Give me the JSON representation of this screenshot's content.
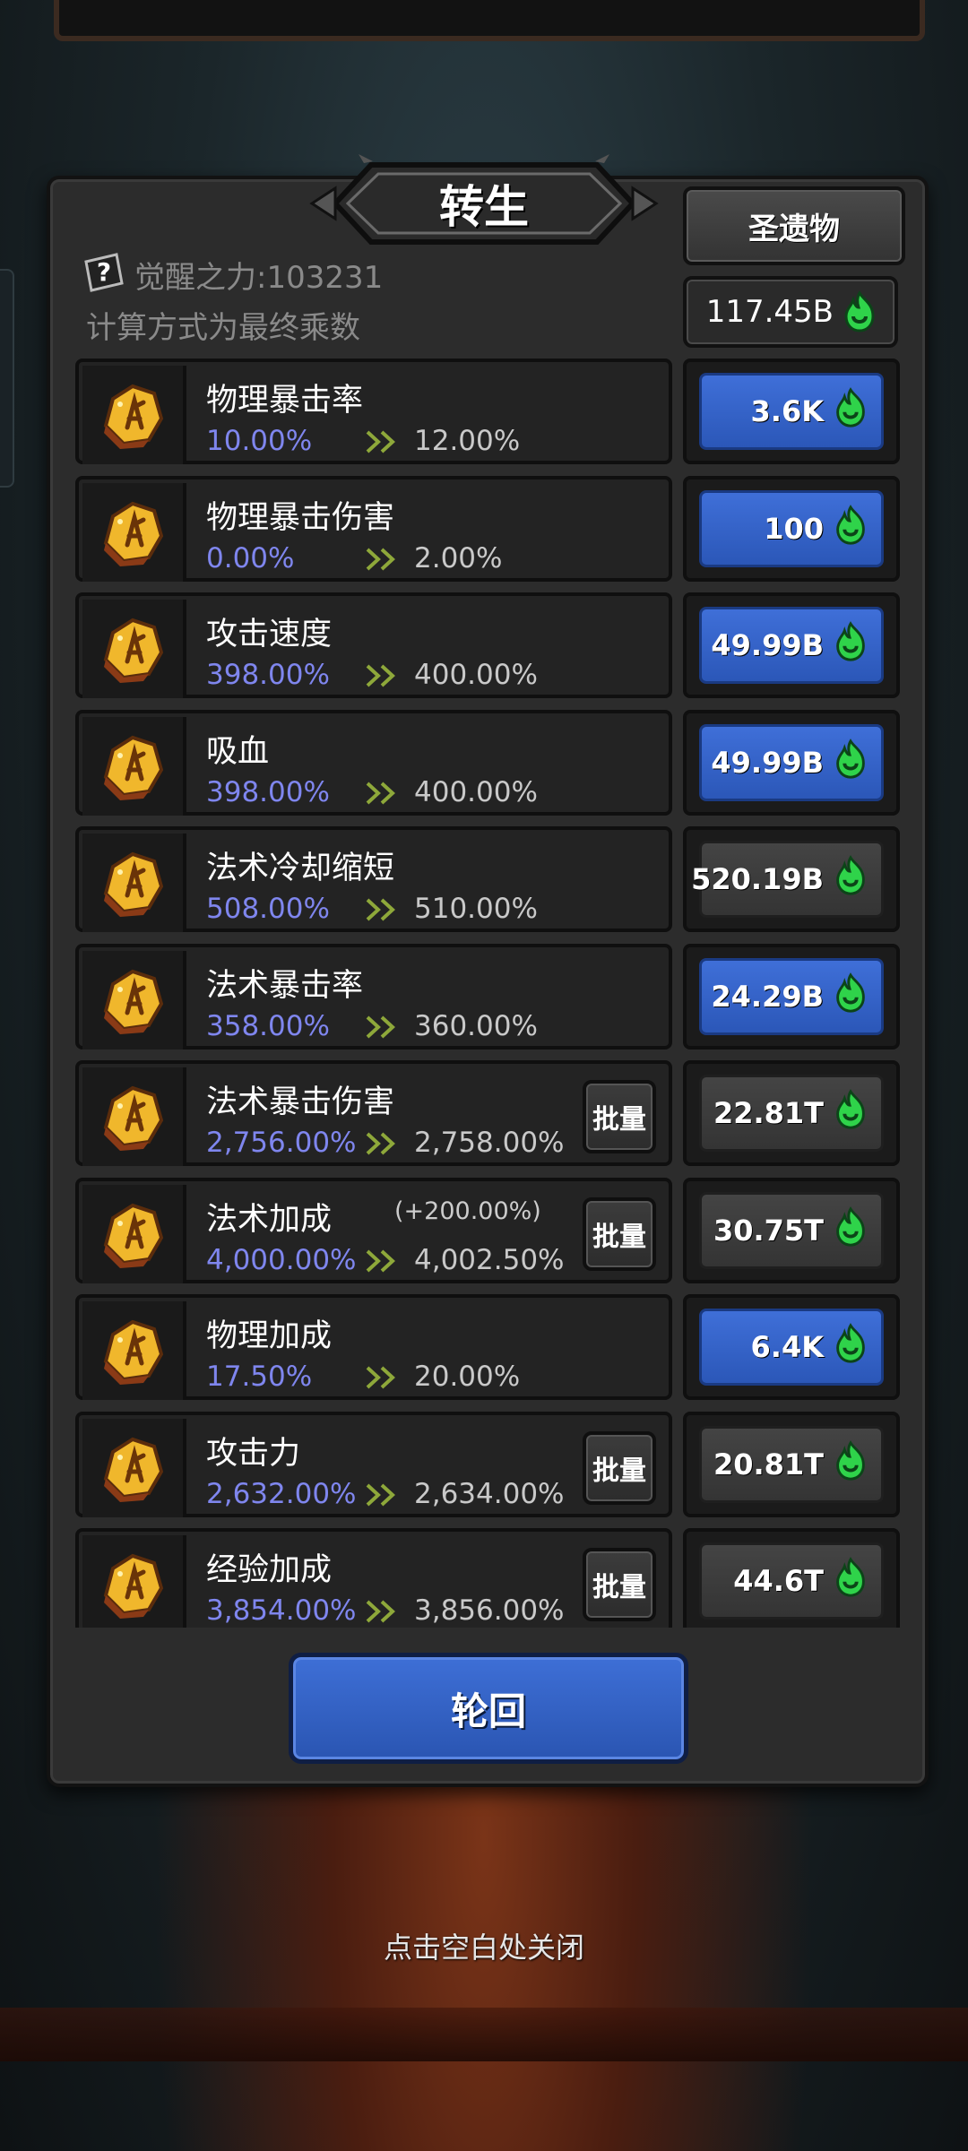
{
  "header": {
    "title": "转生",
    "relic_button": "圣遗物",
    "currency_amount": "117.45B",
    "awaken_power": "觉醒之力:103231",
    "calc_note": "计算方式为最终乘数"
  },
  "stats": [
    {
      "name": "物理暴击率",
      "current": "10.00%",
      "next": "12.00%",
      "cost": "3.6K",
      "cost_style": "blue",
      "batch": false,
      "bonus": ""
    },
    {
      "name": "物理暴击伤害",
      "current": "0.00%",
      "next": "2.00%",
      "cost": "100",
      "cost_style": "blue",
      "batch": false,
      "bonus": ""
    },
    {
      "name": "攻击速度",
      "current": "398.00%",
      "next": "400.00%",
      "cost": "49.99B",
      "cost_style": "blue",
      "batch": false,
      "bonus": ""
    },
    {
      "name": "吸血",
      "current": "398.00%",
      "next": "400.00%",
      "cost": "49.99B",
      "cost_style": "blue",
      "batch": false,
      "bonus": ""
    },
    {
      "name": "法术冷却缩短",
      "current": "508.00%",
      "next": "510.00%",
      "cost": "520.19B",
      "cost_style": "gray",
      "batch": false,
      "bonus": ""
    },
    {
      "name": "法术暴击率",
      "current": "358.00%",
      "next": "360.00%",
      "cost": "24.29B",
      "cost_style": "blue",
      "batch": false,
      "bonus": ""
    },
    {
      "name": "法术暴击伤害",
      "current": "2,756.00%",
      "next": "2,758.00%",
      "cost": "22.81T",
      "cost_style": "gray",
      "batch": true,
      "bonus": ""
    },
    {
      "name": "法术加成",
      "current": "4,000.00%",
      "next": "4,002.50%",
      "cost": "30.75T",
      "cost_style": "gray",
      "batch": true,
      "bonus": "(+200.00%)"
    },
    {
      "name": "物理加成",
      "current": "17.50%",
      "next": "20.00%",
      "cost": "6.4K",
      "cost_style": "blue",
      "batch": false,
      "bonus": ""
    },
    {
      "name": "攻击力",
      "current": "2,632.00%",
      "next": "2,634.00%",
      "cost": "20.81T",
      "cost_style": "gray",
      "batch": true,
      "bonus": ""
    },
    {
      "name": "经验加成",
      "current": "3,854.00%",
      "next": "3,856.00%",
      "cost": "44.6T",
      "cost_style": "gray",
      "batch": true,
      "bonus": ""
    }
  ],
  "batch_label": "批量",
  "rebirth_button": "轮回",
  "close_hint": "点击空白处关闭",
  "icons": {
    "stat": "gold-rune-stone-icon",
    "currency": "green-soul-flame-icon",
    "progress": "double-chevron-right-icon",
    "help": "question-mark-icon"
  },
  "colors": {
    "current_value": "#7f86ee",
    "blue_button": "#3f6fd8",
    "gray_button": "#444444",
    "soul_flame": "#2fd34a"
  }
}
